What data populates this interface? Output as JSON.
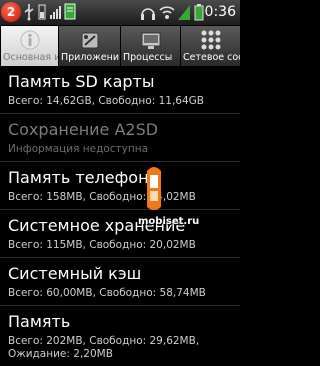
{
  "status_bar": {
    "notification_count": "2",
    "time": "0:36",
    "icons": [
      "notification-badge",
      "usb-icon",
      "battery-small-icon",
      "signal-small-icon",
      "document-icon",
      "headset-icon",
      "wifi-icon",
      "signal-icon",
      "battery-icon"
    ]
  },
  "tabs": [
    {
      "label": "Основная и",
      "icon": "info-icon",
      "active": true
    },
    {
      "label": "Приложени",
      "icon": "applications-icon",
      "active": false
    },
    {
      "label": "Процессы",
      "icon": "processes-icon",
      "active": false
    },
    {
      "label": "Сетевое сос",
      "icon": "network-icon",
      "active": false
    }
  ],
  "list": [
    {
      "title": "Память SD карты",
      "subtitle": "Всего: 14,62GB, Свободно: 11,64GB",
      "enabled": true
    },
    {
      "title": "Сохранение A2SD",
      "subtitle": "Информация недоступна",
      "enabled": false
    },
    {
      "title": "Память телефона",
      "subtitle": "Всего: 158MB, Свободно: 14,02MB",
      "enabled": true
    },
    {
      "title": "Системное хранение",
      "subtitle": "Всего: 115MB, Свободно: 20,02MB",
      "enabled": true
    },
    {
      "title": "Системный кэш",
      "subtitle": "Всего: 60,00MB, Свободно: 58,74MB",
      "enabled": true
    },
    {
      "title": "Память",
      "subtitle": "Всего: 202MB, Свободно: 29,62MB,",
      "enabled": true
    }
  ],
  "list_extra": "Ожидание: 2,20MB",
  "watermark": "mobiset.ru",
  "colors": {
    "watermark_phone": "#f07a1a",
    "badge": "#e02a14",
    "accent_green": "#3aa635"
  }
}
